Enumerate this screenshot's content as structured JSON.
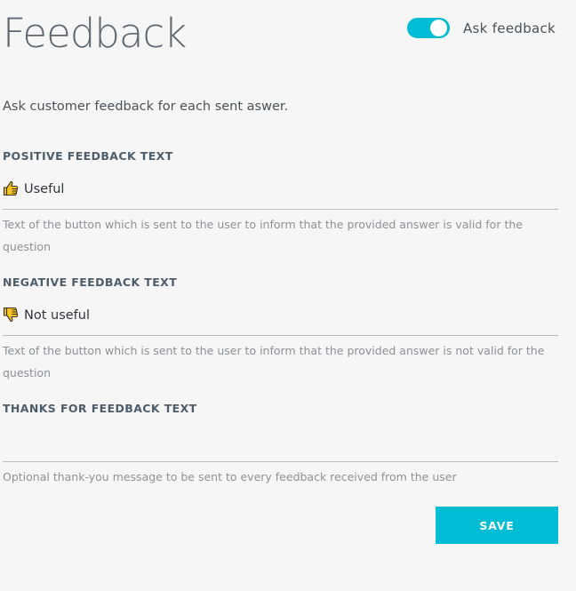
{
  "page": {
    "title": "Feedback",
    "intro": "Ask customer feedback for each sent aswer."
  },
  "toggle": {
    "label": "Ask feedback",
    "on": true
  },
  "fields": [
    {
      "label": "POSITIVE FEEDBACK TEXT",
      "value": "Useful",
      "icon": "thumbs-up-icon",
      "help": "Text of the button which is sent to the user to inform that the provided answer is valid for the question"
    },
    {
      "label": "NEGATIVE FEEDBACK TEXT",
      "value": "Not useful",
      "icon": "thumbs-down-icon",
      "help": "Text of the button which is sent to the user to inform that the provided answer is not valid for the question"
    },
    {
      "label": "THANKS FOR FEEDBACK TEXT",
      "value": "",
      "icon": "",
      "help": "Optional thank-you message to be sent to every feedback received from the user"
    }
  ],
  "actions": {
    "save_label": "SAVE"
  },
  "colors": {
    "accent": "#00bcd4",
    "emoji_fill": "#f7c325",
    "emoji_stroke": "#3a3020"
  }
}
